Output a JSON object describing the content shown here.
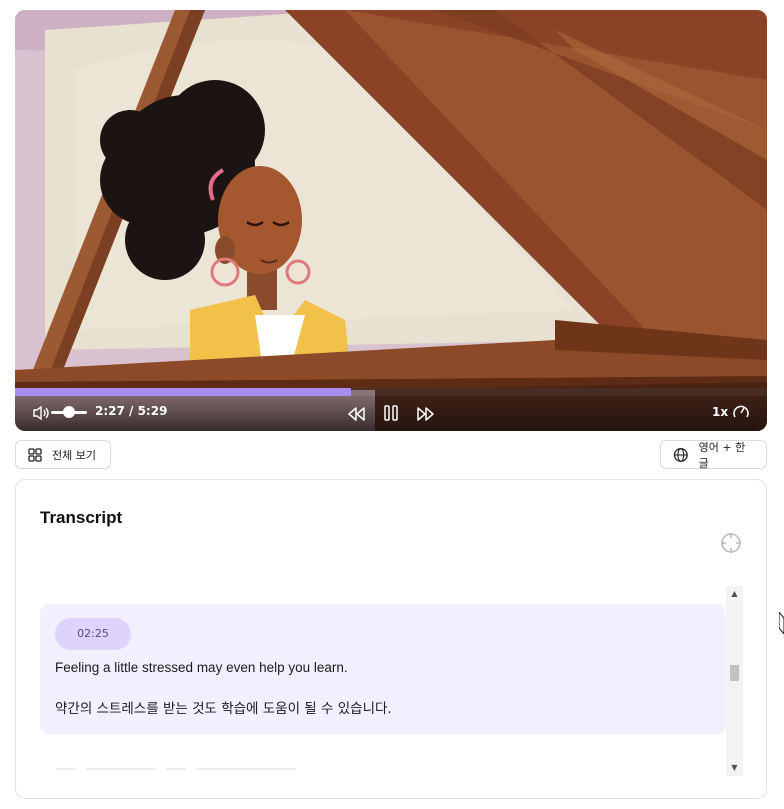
{
  "player": {
    "current_time": "2:27",
    "duration": "5:29",
    "time_display": "2:27 / 5:29",
    "progress_fraction": 0.447,
    "volume_fraction": 0.45,
    "speed_label": "1x",
    "icons": [
      "volume-icon",
      "rewind-icon",
      "pause-icon",
      "fast-forward-icon",
      "speed-gauge-icon"
    ]
  },
  "toolbar": {
    "fullview_label": "전체 보기",
    "language_label": "영어 + 한글",
    "icons": [
      "grid-icon",
      "globe-icon"
    ]
  },
  "transcript": {
    "title": "Transcript",
    "cues": [
      {
        "timestamp": "02:25",
        "english": "Feeling a little stressed may even help you learn.",
        "korean": "약간의 스트레스를 받는 것도 학습에 도움이 될 수 있습니다."
      }
    ]
  },
  "colors": {
    "accent": "#a98cf0",
    "cue_background": "#f2efff",
    "timestamp_chip": "#ddd3fb"
  }
}
